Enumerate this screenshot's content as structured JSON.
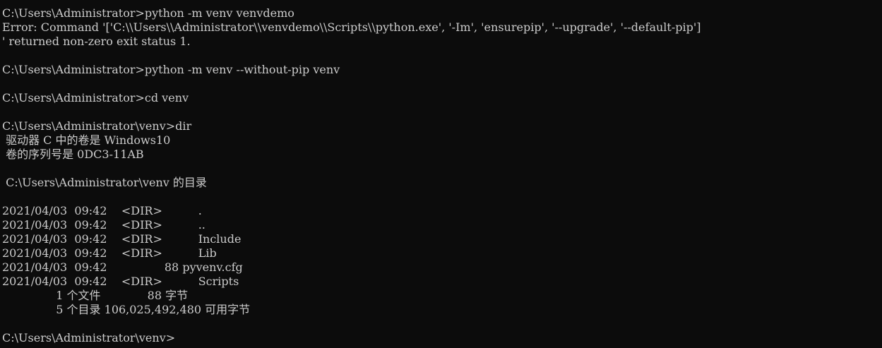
{
  "terminal": {
    "background": "#0c0c0c",
    "foreground": "#cccccc",
    "lines": [
      "C:\\Users\\Administrator>python -m venv venvdemo",
      "Error: Command '['C:\\\\Users\\\\Administrator\\\\venvdemo\\\\Scripts\\\\python.exe', '-Im', 'ensurepip', '--upgrade', '--default-pip']",
      "' returned non-zero exit status 1.",
      "",
      "C:\\Users\\Administrator>python -m venv --without-pip venv",
      "",
      "C:\\Users\\Administrator>cd venv",
      "",
      "C:\\Users\\Administrator\\venv>dir",
      " 驱动器 C 中的卷是 Windows10",
      " 卷的序列号是 0DC3-11AB",
      "",
      " C:\\Users\\Administrator\\venv 的目录",
      "",
      "2021/04/03  09:42    <DIR>          .",
      "2021/04/03  09:42    <DIR>          ..",
      "2021/04/03  09:42    <DIR>          Include",
      "2021/04/03  09:42    <DIR>          Lib",
      "2021/04/03  09:42                88 pyvenv.cfg",
      "2021/04/03  09:42    <DIR>          Scripts",
      "               1 个文件             88 字节",
      "               5 个目录 106,025,492,480 可用字节",
      "",
      "C:\\Users\\Administrator\\venv>"
    ]
  }
}
